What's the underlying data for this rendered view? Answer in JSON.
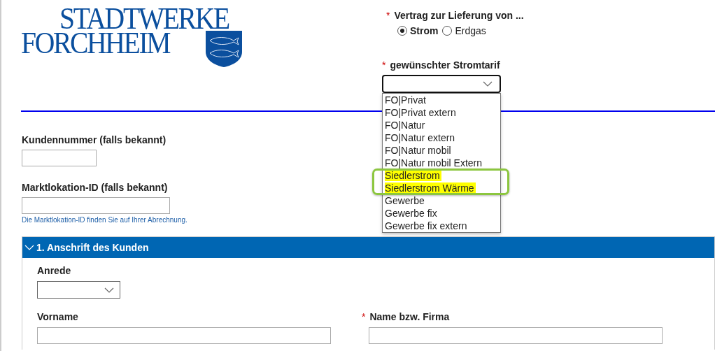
{
  "required_marker": "*",
  "logo": {
    "line_1": "STADTWERKE",
    "line_2": "FORCHHEIM"
  },
  "supply": {
    "label": "Vertrag zur Lieferung von ...",
    "required": true,
    "options": [
      {
        "label": "Strom",
        "selected": true
      },
      {
        "label": "Erdgas",
        "selected": false
      }
    ]
  },
  "tariff": {
    "label": "gewünschter Stromtarif",
    "required": true,
    "expanded": true,
    "options": [
      {
        "label": "FO|Privat",
        "highlighted": false
      },
      {
        "label": "FO|Privat extern",
        "highlighted": false
      },
      {
        "label": "FO|Natur",
        "highlighted": false
      },
      {
        "label": "FO|Natur extern",
        "highlighted": false
      },
      {
        "label": "FO|Natur mobil",
        "highlighted": false
      },
      {
        "label": "FO|Natur mobil Extern",
        "highlighted": false
      },
      {
        "label": "Siedlerstrom",
        "highlighted": true
      },
      {
        "label": "Siedlerstrom Wärme",
        "highlighted": true
      },
      {
        "label": "Gewerbe",
        "highlighted": false
      },
      {
        "label": "Gewerbe fix",
        "highlighted": false
      },
      {
        "label": "Gewerbe fix extern",
        "highlighted": false
      }
    ]
  },
  "customer_number": {
    "label": "Kundennummer (falls bekannt)"
  },
  "market_location": {
    "label": "Marktlokation-ID (falls bekannt)",
    "hint": "Die Marktlokation-ID finden Sie auf Ihrer Abrechnung."
  },
  "section": {
    "title": "1. Anschrift des Kunden",
    "expanded": true,
    "fields": [
      {
        "kind": "select",
        "label": "Anrede",
        "required": false
      },
      {
        "kind": "text",
        "label": "Vorname",
        "required": false
      },
      {
        "kind": "text",
        "label": "Name bzw. Firma",
        "required": true
      }
    ]
  }
}
